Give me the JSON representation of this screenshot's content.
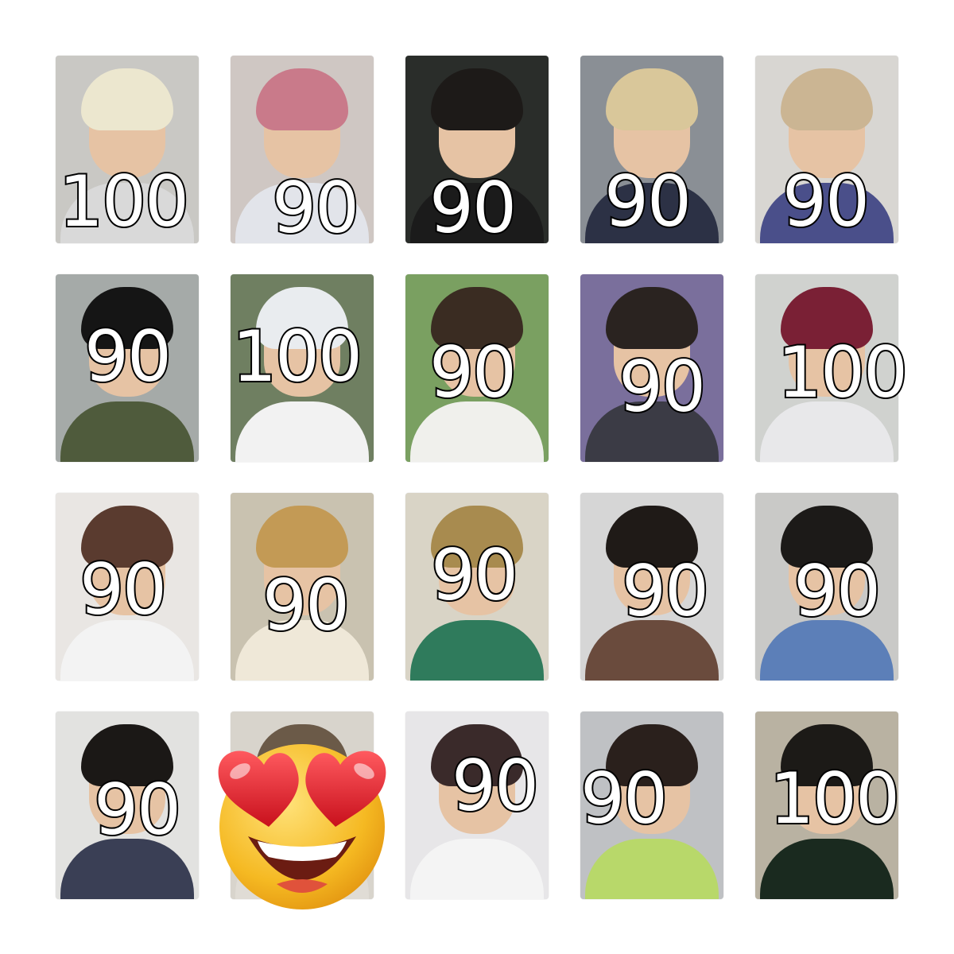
{
  "cards": [
    {
      "price": "100",
      "bg": "#c9c8c4",
      "hair": "#ece7cf",
      "top": "#d9d9d9"
    },
    {
      "price": "90",
      "bg": "#cfc7c3",
      "hair": "#c97a8a",
      "top": "#e2e4ea"
    },
    {
      "price": "90",
      "bg": "#2a2d2a",
      "hair": "#1d1a18",
      "top": "#1b1b1b"
    },
    {
      "price": "90",
      "bg": "#8a8f95",
      "hair": "#d9c79a",
      "top": "#2c3145"
    },
    {
      "price": "90",
      "bg": "#d8d6d2",
      "hair": "#cbb593",
      "top": "#4a4f8a"
    },
    {
      "price": "90",
      "bg": "#a5aaa8",
      "hair": "#151515",
      "top": "#4f5b3c"
    },
    {
      "price": "100",
      "bg": "#6f7f61",
      "hair": "#e9ecef",
      "top": "#f2f2f2"
    },
    {
      "price": "90",
      "bg": "#7aa061",
      "hair": "#3a2c22",
      "top": "#f0f0ec"
    },
    {
      "price": "90",
      "bg": "#7a6f9c",
      "hair": "#2a2320",
      "top": "#3b3b45"
    },
    {
      "price": "100",
      "bg": "#d0d2cf",
      "hair": "#7a2035",
      "top": "#e8e8ea"
    },
    {
      "price": "90",
      "bg": "#e9e6e3",
      "hair": "#5a3b2f",
      "top": "#f3f3f3"
    },
    {
      "price": "90",
      "bg": "#c9c2b0",
      "hair": "#c39a55",
      "top": "#efe8d8"
    },
    {
      "price": "90",
      "bg": "#d9d4c6",
      "hair": "#a88b4f",
      "top": "#2f7b5c"
    },
    {
      "price": "90",
      "bg": "#d6d6d6",
      "hair": "#1f1a17",
      "top": "#6a4b3d"
    },
    {
      "price": "90",
      "bg": "#c9c9c7",
      "hair": "#1c1a18",
      "top": "#5c7fb8"
    },
    {
      "price": "90",
      "bg": "#e2e2e0",
      "hair": "#1b1816",
      "top": "#3a3f55"
    },
    {
      "price": "",
      "bg": "#d8d4cc",
      "hair": "#6b5a48",
      "top": "#e0dcd5"
    },
    {
      "price": "90",
      "bg": "#e7e6e8",
      "hair": "#3a2a2a",
      "top": "#f4f4f4"
    },
    {
      "price": "90",
      "bg": "#bfc1c4",
      "hair": "#2a201c",
      "top": "#b8d86a"
    },
    {
      "price": "100",
      "bg": "#b9b2a2",
      "hair": "#1c1a17",
      "top": "#1a2a1f"
    }
  ],
  "emoji": {
    "name": "smiling-face-with-heart-eyes-icon",
    "face": "#f7c230",
    "heart": "#e8242f"
  }
}
